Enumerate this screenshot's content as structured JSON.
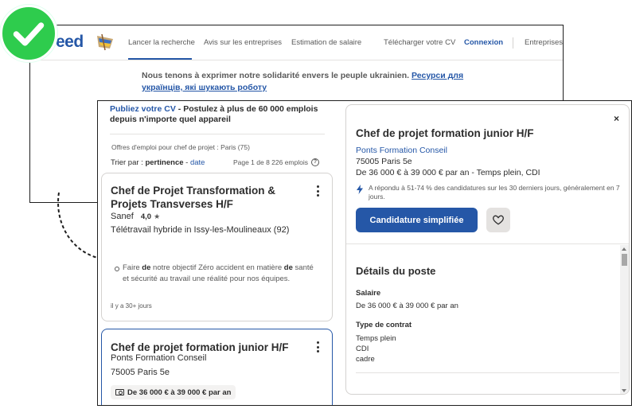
{
  "nav": {
    "logo": "eed",
    "items": [
      "Lancer la recherche",
      "Avis sur les entreprises",
      "Estimation de salaire",
      "Télécharger votre CV",
      "Connexion",
      "Entreprises"
    ]
  },
  "banner": {
    "text": "Nous tenons à exprimer notre solidarité envers le peuple ukrainien.",
    "link": "Ресурси для українців, які шукають роботу"
  },
  "promo": {
    "link": "Publiez votre CV",
    "text": " - Postulez à plus de 60 000 emplois depuis n'importe quel appareil"
  },
  "results": {
    "meta": "Offres d'emploi pour chef de projet : Paris (75)",
    "sort_prefix": "Trier par : ",
    "sort_active": "pertinence",
    "sort_sep": " - ",
    "sort_alt": "date",
    "page_info": "Page 1 de 8 226 emplois",
    "help": "?"
  },
  "cards": [
    {
      "title": "Chef de Projet Transformation & Projets Transverses H/F",
      "company": "Sanef",
      "rating": "4,0",
      "star": "★",
      "location": "Télétravail hybride in Issy-les-Moulineaux (92)",
      "snippet_parts": [
        "Faire ",
        "de",
        " notre objectif Zéro accident en matière ",
        "de",
        " santé et sécurité au travail une réalité pour nos équipes."
      ],
      "age": "il y a 30+ jours"
    },
    {
      "title": "Chef de projet formation junior H/F",
      "company": "Ponts Formation Conseil",
      "location": "75005 Paris 5e",
      "salary": "De 36 000 € à 39 000 € par an"
    }
  ],
  "detail": {
    "close": "×",
    "title": "Chef de projet formation junior H/F",
    "company": "Ponts Formation Conseil",
    "location": "75005 Paris 5e",
    "salary_line": "De 36 000 € à 39 000 € par an  - Temps plein, CDI",
    "response": "A répondu à 51-74 % des candidatures sur les 30 derniers jours, généralement en 7 jours.",
    "apply": "Candidature simplifiée",
    "section_title": "Détails du poste",
    "salary_label": "Salaire",
    "salary_value": "De 36 000 € à 39 000 € par an",
    "contract_label": "Type de contrat",
    "contract_values": [
      "Temps plein",
      "CDI",
      "cadre"
    ]
  },
  "colors": {
    "accent": "#2557a7",
    "badge": "#2ecc4d"
  },
  "icons": [
    "check-icon",
    "flag-logo-icon",
    "kebab-icon",
    "star-icon",
    "money-icon",
    "help-icon",
    "close-icon",
    "bolt-icon",
    "heart-icon",
    "scroll-up-icon",
    "scroll-down-icon",
    "curved-arrow-icon"
  ]
}
